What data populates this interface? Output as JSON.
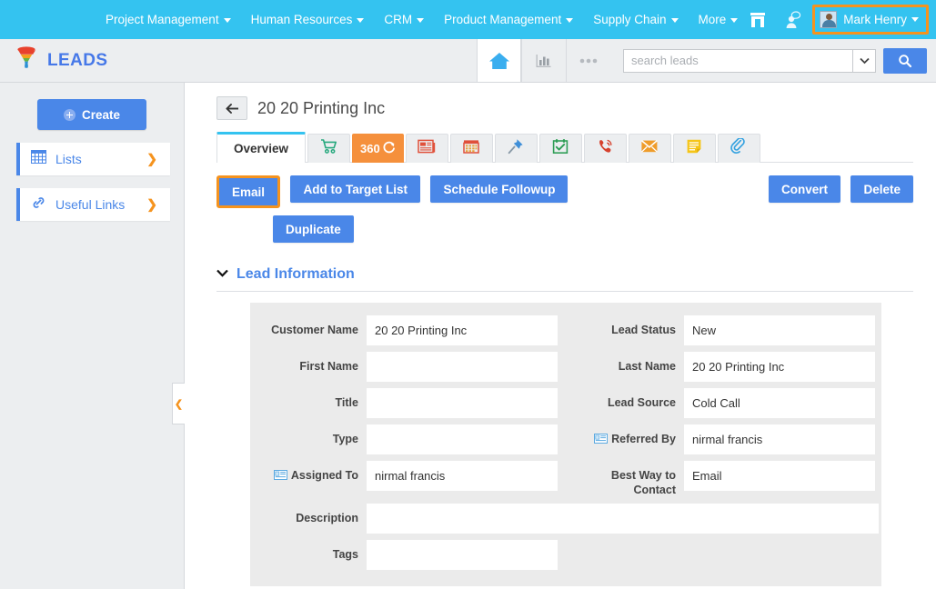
{
  "topnav": {
    "menu": [
      {
        "label": "Project Management",
        "caret": true
      },
      {
        "label": "Human Resources",
        "caret": true
      },
      {
        "label": "CRM",
        "caret": true
      },
      {
        "label": "Product Management",
        "caret": true
      },
      {
        "label": "Supply Chain",
        "caret": true
      },
      {
        "label": "More",
        "caret": true
      }
    ],
    "icons": [
      "store-icon",
      "notifications-icon"
    ],
    "user": {
      "name": "Mark Henry",
      "highlight_color": "#f5931e"
    },
    "bg_color": "#34c3f0"
  },
  "module": {
    "title": "LEADS",
    "logo_icon": "funnel-icon",
    "tools": [
      {
        "name": "home-icon",
        "active": true
      },
      {
        "name": "chart-bar-icon",
        "active": false
      },
      {
        "name": "more-dots-icon",
        "active": false
      }
    ],
    "search": {
      "placeholder": "search leads",
      "value": "",
      "dropdown_icon": "chevron-down-icon",
      "button_icon": "search-icon",
      "button_color": "#4a87e8"
    }
  },
  "sidebar": {
    "create_label": "Create",
    "items": [
      {
        "label": "Lists",
        "icon": "grid-icon",
        "chevron": "❯"
      },
      {
        "label": "Useful Links",
        "icon": "link-icon",
        "chevron": "❯"
      }
    ],
    "collapse_chevron": "❮"
  },
  "record": {
    "back_icon": "arrow-left-icon",
    "title": "20 20 Printing Inc"
  },
  "tabs": [
    {
      "label": "Overview",
      "type": "text",
      "active": true,
      "icon": null
    },
    {
      "label": "",
      "type": "icon",
      "active": false,
      "icon": "shopping-cart-icon"
    },
    {
      "label": "360",
      "type": "orange",
      "active": false,
      "icon": "refresh-360-icon"
    },
    {
      "label": "",
      "type": "icon",
      "active": false,
      "icon": "document-icon"
    },
    {
      "label": "",
      "type": "icon",
      "active": false,
      "icon": "calendar-icon"
    },
    {
      "label": "",
      "type": "icon",
      "active": false,
      "icon": "pushpin-icon"
    },
    {
      "label": "",
      "type": "icon",
      "active": false,
      "icon": "calendar-check-icon"
    },
    {
      "label": "",
      "type": "icon",
      "active": false,
      "icon": "phone-call-icon"
    },
    {
      "label": "",
      "type": "icon",
      "active": false,
      "icon": "envelope-icon"
    },
    {
      "label": "",
      "type": "icon",
      "active": false,
      "icon": "note-icon"
    },
    {
      "label": "",
      "type": "icon",
      "active": false,
      "icon": "paperclip-icon"
    }
  ],
  "actions": {
    "email": "Email",
    "add_to_target_list": "Add to Target List",
    "schedule_followup": "Schedule Followup",
    "duplicate": "Duplicate",
    "convert": "Convert",
    "delete": "Delete",
    "email_highlight_color": "#f5931e"
  },
  "section": {
    "title": "Lead Information",
    "collapse_icon": "chevron-down-icon"
  },
  "form": {
    "rows": [
      {
        "left": {
          "label": "Customer Name",
          "value": "20 20 Printing Inc",
          "icon": null
        },
        "right": {
          "label": "Lead Status",
          "value": "New",
          "icon": null
        }
      },
      {
        "left": {
          "label": "First Name",
          "value": "",
          "icon": null
        },
        "right": {
          "label": "Last Name",
          "value": "20 20 Printing Inc",
          "icon": null
        }
      },
      {
        "left": {
          "label": "Title",
          "value": "",
          "icon": null
        },
        "right": {
          "label": "Lead Source",
          "value": "Cold Call",
          "icon": null
        }
      },
      {
        "left": {
          "label": "Type",
          "value": "",
          "icon": null
        },
        "right": {
          "label": "Referred By",
          "value": "nirmal francis",
          "icon": "contact-card-icon"
        }
      },
      {
        "left": {
          "label": "Assigned To",
          "value": "nirmal francis",
          "icon": "contact-card-icon"
        },
        "right": {
          "label": "Best Way to Contact",
          "value": "Email",
          "icon": null
        }
      }
    ],
    "description": {
      "label": "Description",
      "value": ""
    },
    "tags": {
      "label": "Tags",
      "value": ""
    }
  }
}
